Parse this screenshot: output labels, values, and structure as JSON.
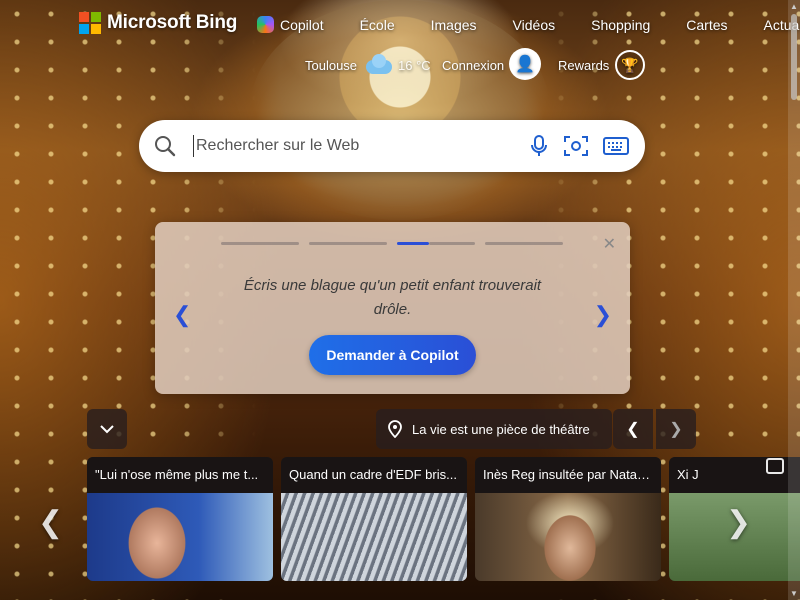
{
  "brand": {
    "name": "Microsoft Bing"
  },
  "nav": {
    "items": [
      {
        "label": "Copilot",
        "icon": "copilot-icon"
      },
      {
        "label": "École"
      },
      {
        "label": "Images"
      },
      {
        "label": "Vidéos"
      },
      {
        "label": "Shopping"
      },
      {
        "label": "Cartes"
      },
      {
        "label": "Actualit"
      }
    ]
  },
  "header": {
    "location": "Toulouse",
    "temperature": "16 °C",
    "weather_icon": "cloud-icon",
    "signin_label": "Connexion",
    "rewards_label": "Rewards"
  },
  "search": {
    "placeholder": "Rechercher sur le Web"
  },
  "copilot_card": {
    "prompt": "Écris une blague qu'un petit enfant trouverait drôle.",
    "button_label": "Demander à Copilot",
    "active_step": 3,
    "step_count": 4
  },
  "image_caption": {
    "label": "La vie est une pièce de théâtre"
  },
  "news": [
    {
      "title": "\"Lui n'ose même plus me t..."
    },
    {
      "title": "Quand un cadre d'EDF bris..."
    },
    {
      "title": "Inès Reg insultée par Natas..."
    },
    {
      "title": "Xi J"
    }
  ],
  "colors": {
    "accent": "#2a4fd6",
    "button_start": "#1f6fe8"
  }
}
